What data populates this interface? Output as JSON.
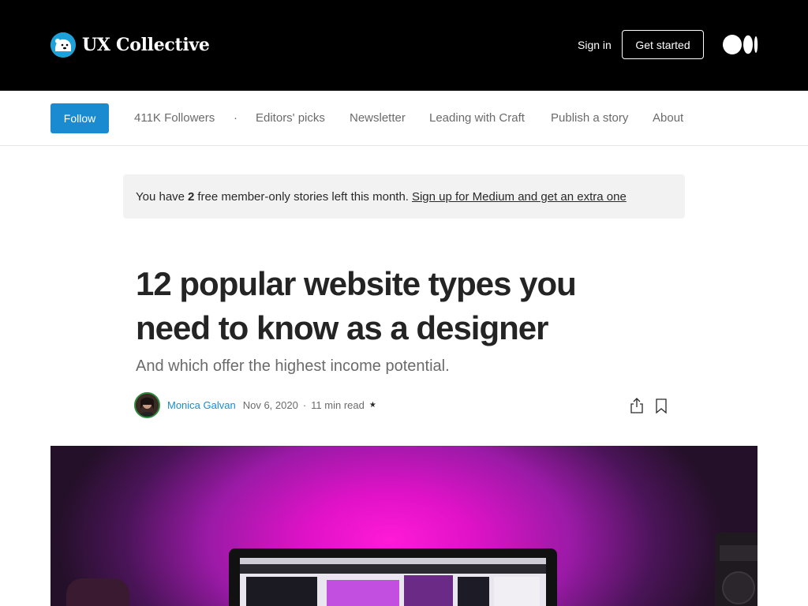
{
  "header": {
    "publication_name": "UX Collective",
    "sign_in": "Sign in",
    "get_started": "Get started",
    "logo_icon": "polar-bear-logo",
    "medium_icon": "medium-logo-icon"
  },
  "nav": {
    "follow": "Follow",
    "followers": "411K Followers",
    "separator": "·",
    "items": [
      "Editors' picks",
      "Newsletter",
      "Leading with Craft",
      "Publish a story",
      "About"
    ]
  },
  "banner": {
    "prefix": "You have",
    "count": "2",
    "suffix": "free member-only stories left this month.",
    "link": "Sign up for Medium and get an extra one"
  },
  "article": {
    "title": "12 popular website types you need to know as a designer",
    "subtitle": "And which offer the highest income potential.",
    "author": "Monica Galvan",
    "date": "Nov 6, 2020",
    "dot": "·",
    "read_time": "11 min read",
    "star": "★",
    "share_icon": "share-icon",
    "bookmark_icon": "bookmark-icon"
  },
  "colors": {
    "header_bg": "#000000",
    "accent": "#1a8bd0",
    "hero_magenta": "#ff1ad8"
  }
}
